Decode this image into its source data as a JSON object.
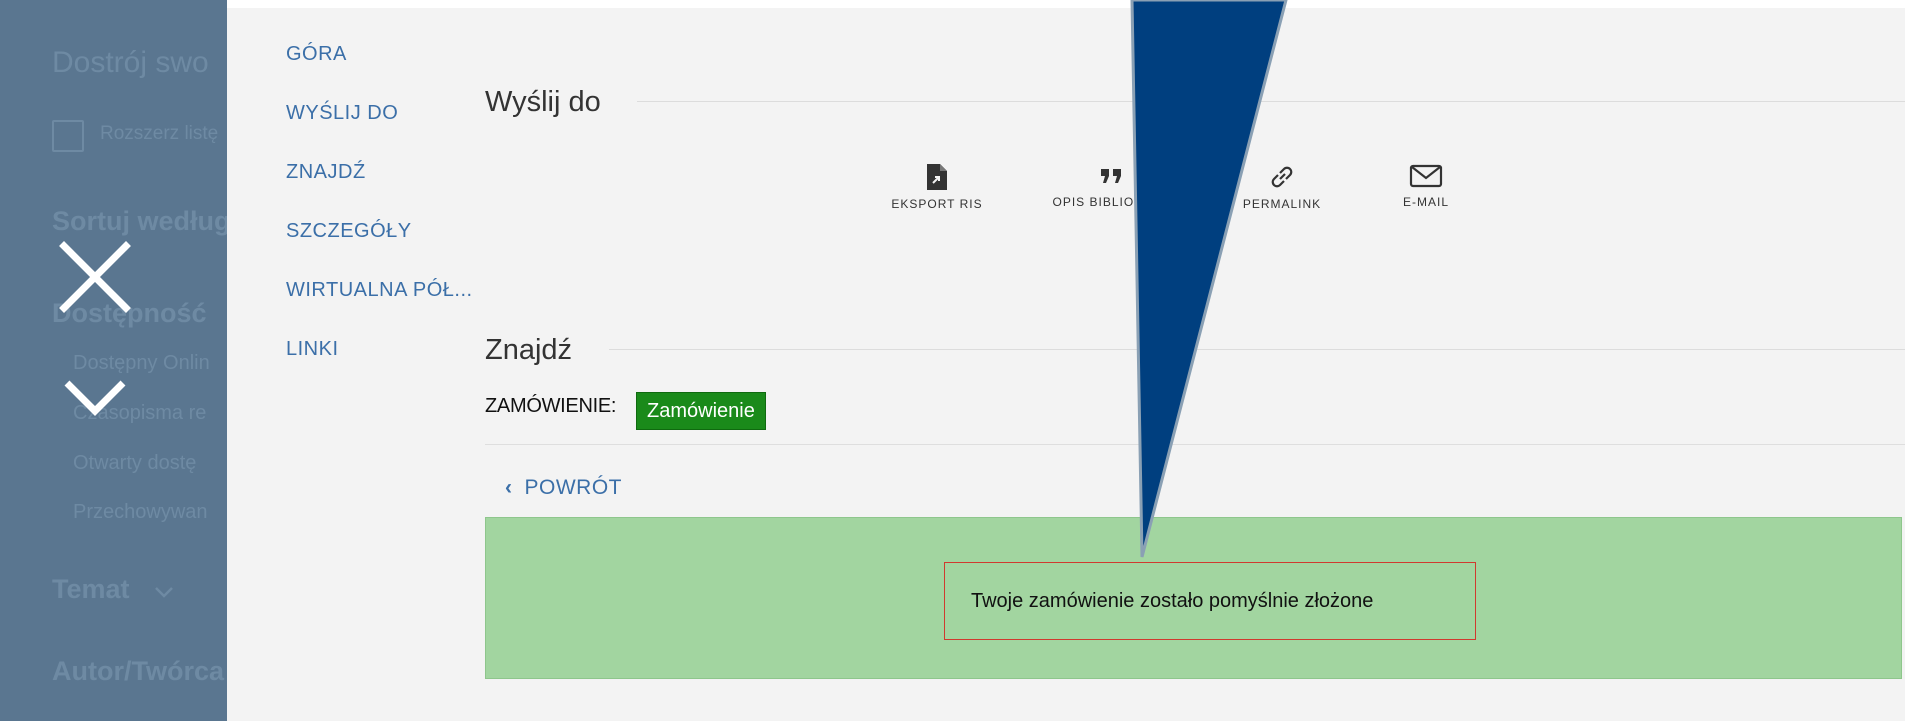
{
  "left_panel": {
    "title": "Dostrój swo",
    "expand_label": "Rozszerz listę",
    "sort_heading": "Sortuj według",
    "availability_heading": "Dostępność",
    "availability_options": [
      "Dostępny Onlin",
      "Czasopisma re",
      "Otwarty dostę",
      "Przechowywan"
    ],
    "topic_heading": "Temat",
    "author_heading": "Autor/Twórca"
  },
  "section_nav": {
    "items": [
      "GÓRA",
      "WYŚLIJ DO",
      "ZNAJDŹ",
      "SZCZEGÓŁY",
      "WIRTUALNA PÓŁ...",
      "LINKI"
    ]
  },
  "send_to": {
    "heading": "Wyślij do",
    "actions": [
      {
        "label": "EKSPORT RIS",
        "icon": "file-export-icon"
      },
      {
        "label": "OPIS BIBLIOGRAF",
        "icon": "quote-icon"
      },
      {
        "label": "PERMALINK",
        "icon": "link-icon"
      },
      {
        "label": "E-MAIL",
        "icon": "mail-icon"
      }
    ]
  },
  "find": {
    "heading": "Znajdź",
    "order_label": "ZAMÓWIENIE:",
    "order_badge": "Zamówienie",
    "back_label": "POWRÓT",
    "success_message": "Twoje zamówienie zostało pomyślnie złożone"
  },
  "colors": {
    "panel_overlay": "#5a7690",
    "link": "#3b6fa8",
    "badge_green": "#1a8a1a",
    "success_bg": "#a2d5a0",
    "highlight_border": "#d03a2f",
    "arrow_fill": "#003f7f"
  }
}
